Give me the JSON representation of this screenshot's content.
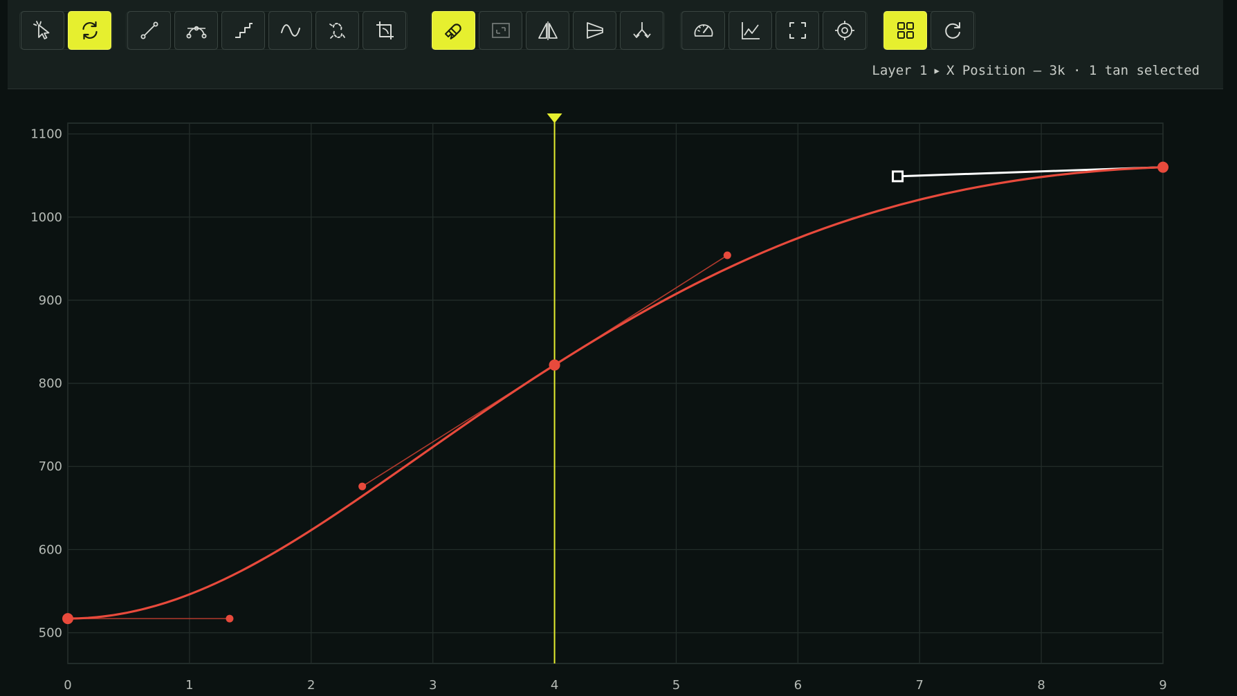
{
  "toolbar": {
    "groups": [
      [
        {
          "id": "select-tool",
          "icon": "cursor-sparkle-icon",
          "active": false
        },
        {
          "id": "loop-tool",
          "icon": "cycle-icon",
          "active": true
        }
      ],
      [
        {
          "id": "linear-interp",
          "icon": "linear-curve-icon",
          "active": false
        },
        {
          "id": "bezier-interp",
          "icon": "bezier-curve-icon",
          "active": false
        },
        {
          "id": "stepped-interp",
          "icon": "stairs-icon",
          "active": false
        },
        {
          "id": "smooth-interp",
          "icon": "sine-wave-icon",
          "active": false
        },
        {
          "id": "break-tangents",
          "icon": "broken-link-icon",
          "active": false
        },
        {
          "id": "flatten-tangents",
          "icon": "corner-crop-icon",
          "active": false
        }
      ],
      [
        {
          "id": "snap",
          "icon": "magnet-icon",
          "active": true
        },
        {
          "id": "frame-bounds",
          "icon": "frame-resize-icon",
          "active": false,
          "dim": true
        },
        {
          "id": "mirror",
          "icon": "flip-horizontal-icon",
          "active": false
        },
        {
          "id": "align",
          "icon": "align-wedge-icon",
          "active": false
        },
        {
          "id": "split",
          "icon": "fork-arrows-icon",
          "active": false
        }
      ],
      [
        {
          "id": "speed-graph",
          "icon": "speedometer-icon",
          "active": false
        },
        {
          "id": "value-graph",
          "icon": "line-graph-icon",
          "active": false
        },
        {
          "id": "fit-view",
          "icon": "fullscreen-icon",
          "active": false
        },
        {
          "id": "focus-selection",
          "icon": "target-icon",
          "active": false
        }
      ],
      [
        {
          "id": "grid-toggle",
          "icon": "grid-icon",
          "active": true
        },
        {
          "id": "reset",
          "icon": "redo-circle-icon",
          "active": false
        }
      ]
    ]
  },
  "status": {
    "layer": "Layer 1",
    "separator": "▸",
    "property": "X Position — 3k · 1 tan selected"
  },
  "chart_data": {
    "type": "line",
    "x_ticks": [
      "0",
      "1",
      "2",
      "3",
      "4",
      "5",
      "6",
      "7",
      "8",
      "9"
    ],
    "y_ticks": [
      "500",
      "600",
      "700",
      "800",
      "900",
      "1000",
      "1100"
    ],
    "xlim": [
      0,
      9
    ],
    "ylim": [
      463,
      1113
    ],
    "grid": true,
    "playhead": 4,
    "curve_color": "#e84a3c",
    "playhead_color": "#e6ef2f",
    "keyframes": [
      {
        "x": 0,
        "y": 517,
        "out": {
          "x": 1.33,
          "y": 517
        }
      },
      {
        "x": 4,
        "y": 822,
        "in": {
          "x": 2.42,
          "y": 676
        },
        "out": {
          "x": 5.42,
          "y": 954
        }
      },
      {
        "x": 9,
        "y": 1060,
        "in": {
          "x": 6.82,
          "y": 1049
        },
        "in_selected": true
      }
    ]
  }
}
